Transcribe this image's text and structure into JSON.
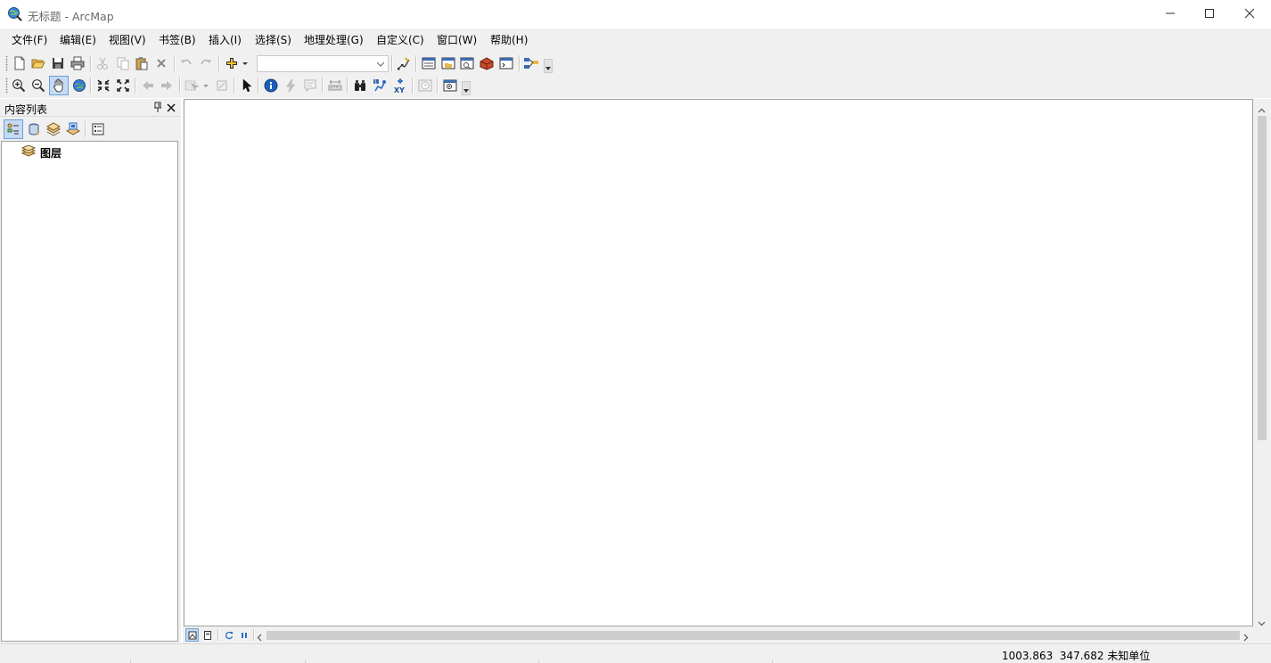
{
  "window": {
    "title": "无标题 - ArcMap",
    "controls": [
      "minimize",
      "maximize",
      "close"
    ]
  },
  "menubar": {
    "items": [
      {
        "label": "文件(F)"
      },
      {
        "label": "编辑(E)"
      },
      {
        "label": "视图(V)"
      },
      {
        "label": "书签(B)"
      },
      {
        "label": "插入(I)"
      },
      {
        "label": "选择(S)"
      },
      {
        "label": "地理处理(G)"
      },
      {
        "label": "自定义(C)"
      },
      {
        "label": "窗口(W)"
      },
      {
        "label": "帮助(H)"
      }
    ]
  },
  "standard_toolbar": {
    "scale_value": "",
    "tools": [
      "new-document",
      "open",
      "save",
      "print",
      "cut",
      "copy",
      "paste",
      "delete",
      "undo",
      "redo",
      "add-data",
      "scale",
      "editor-toolbar",
      "table-of-contents",
      "catalog",
      "search",
      "arctoolbox",
      "python",
      "model-builder"
    ]
  },
  "tools_toolbar": {
    "tools": [
      "zoom-in",
      "zoom-out",
      "pan",
      "full-extent",
      "fixed-zoom-in",
      "fixed-zoom-out",
      "back-extent",
      "forward-extent",
      "select-features",
      "clear-selection",
      "select-elements",
      "identify",
      "hyperlink",
      "html-popup",
      "measure",
      "find",
      "find-route",
      "go-to-xy",
      "time-slider",
      "create-viewer-window"
    ]
  },
  "toc": {
    "title": "内容列表",
    "tabs": [
      "list-by-drawing-order",
      "list-by-source",
      "list-by-visibility",
      "list-by-selection",
      "options"
    ],
    "root_label": "图层"
  },
  "statusbar": {
    "x": "1003.863",
    "y": "347.682",
    "units": "未知单位"
  },
  "colors": {
    "chrome": "#f0f0f0",
    "canvas": "#ffffff",
    "accent": "#2a6cc4",
    "border": "#a0a0a0"
  }
}
